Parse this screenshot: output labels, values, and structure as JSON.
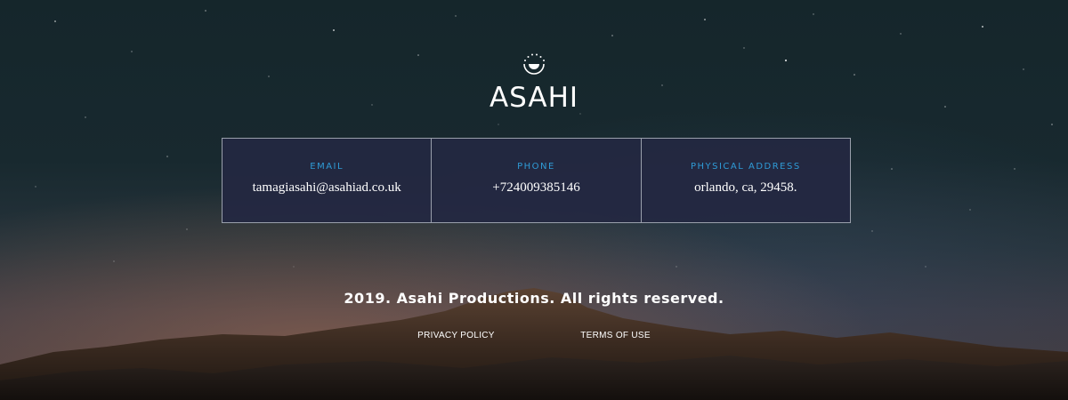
{
  "brand": {
    "name": "ASAHI",
    "logo_icon": "sun-moon-icon"
  },
  "contact": {
    "items": [
      {
        "label": "EMAIL",
        "value": "tamagiasahi@asahiad.co.uk"
      },
      {
        "label": "PHONE",
        "value": "+724009385146"
      },
      {
        "label": "PHYSICAL ADDRESS",
        "value": "orlando, ca, 29458."
      }
    ]
  },
  "footer": {
    "copyright": "2019. Asahi Productions. All rights reserved.",
    "links": [
      {
        "label": "PRIVACY POLICY"
      },
      {
        "label": "TERMS OF USE"
      }
    ]
  },
  "colors": {
    "accent": "#2f9bd6",
    "card_bg": "#242842",
    "text": "#ffffff"
  }
}
